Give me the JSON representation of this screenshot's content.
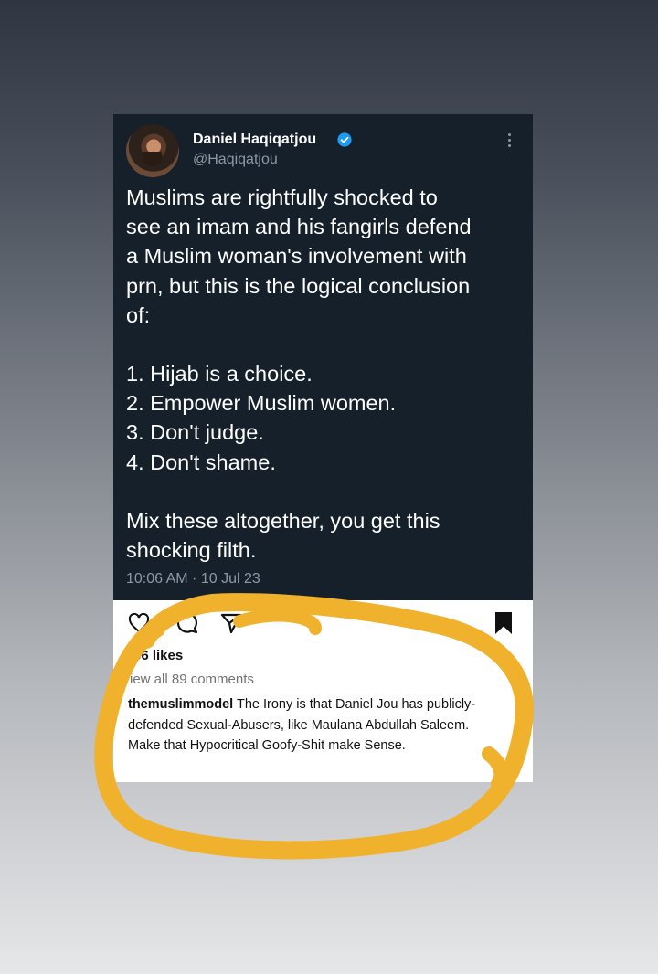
{
  "tweet": {
    "author_name": "Daniel Haqiqatjou",
    "handle": "@Haqiqatjou",
    "body_intro": [
      "Muslims are rightfully shocked to",
      "see an imam and his fangirls defend",
      "a Muslim woman's involvement with",
      "prn, but this is the logical conclusion",
      "of:"
    ],
    "list_items": [
      "1. Hijab is a choice.",
      "2. Empower Muslim women.",
      "3. Don't judge.",
      "4. Don't shame."
    ],
    "body_outro": [
      "Mix these altogether, you get this",
      "shocking filth."
    ],
    "timestamp": "10:06 AM · 10 Jul 23"
  },
  "instagram": {
    "likes": "66 likes",
    "view_comments": "iew all 89 comments",
    "comment_user": "themuslimmodel",
    "comment_text": " The Irony is that Daniel Jou has publicly-defended Sexual-Abusers, like Maulana Abdullah Saleem. Make that Hypocritical Goofy-Shit make Sense."
  },
  "colors": {
    "tweet_bg": "#15202b",
    "verified_blue": "#1d9bf0",
    "muted_text": "#8b98a5",
    "highlight_stroke": "#f0b12d"
  },
  "icons": [
    "verified-badge-icon",
    "more-options-icon",
    "heart-icon",
    "comment-icon",
    "share-icon",
    "bookmark-icon"
  ]
}
